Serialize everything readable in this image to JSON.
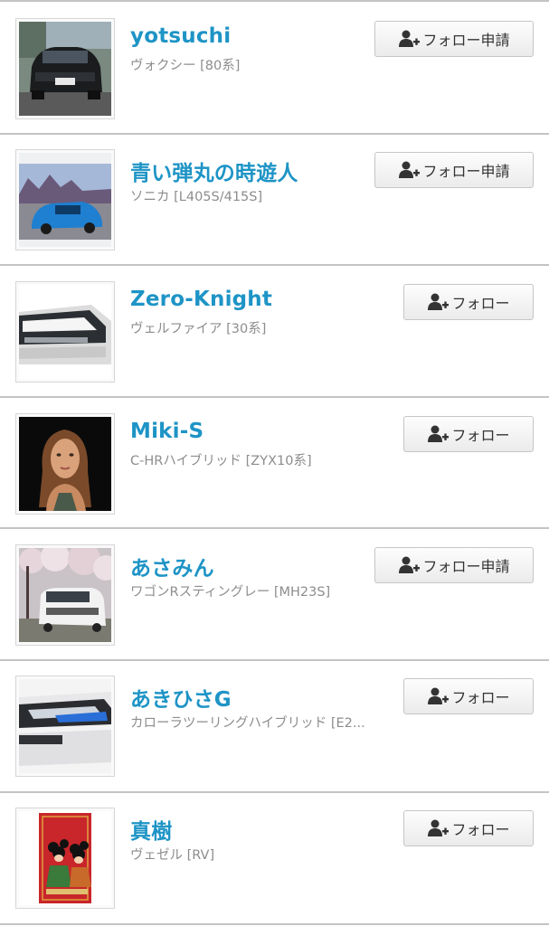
{
  "users": [
    {
      "name": "yotsuchi",
      "car": "ヴォクシー [80系]",
      "button": "フォロー申請",
      "avatar_icon": "car-front-dark-photo"
    },
    {
      "name": "青い弾丸の時遊人",
      "car": "ソニカ [L405S/415S]",
      "button": "フォロー申請",
      "avatar_icon": "blue-car-photo"
    },
    {
      "name": "Zero-Knight",
      "car": "ヴェルファイア [30系]",
      "button": "フォロー",
      "avatar_icon": "car-headlight-photo"
    },
    {
      "name": "Miki-S",
      "car": "C-HRハイブリッド [ZYX10系]",
      "button": "フォロー",
      "avatar_icon": "doll-portrait-photo"
    },
    {
      "name": "あさみん",
      "car": "ワゴンRスティングレー [MH23S]",
      "button": "フォロー申請",
      "avatar_icon": "white-car-blossom-photo"
    },
    {
      "name": "あきひさG",
      "car": "カローラツーリングハイブリッド [E2...",
      "button": "フォロー",
      "avatar_icon": "headlight-closeup-photo"
    },
    {
      "name": "真樹",
      "car": "ヴェゼル [RV]",
      "button": "フォロー",
      "avatar_icon": "mouse-card-photo"
    }
  ]
}
